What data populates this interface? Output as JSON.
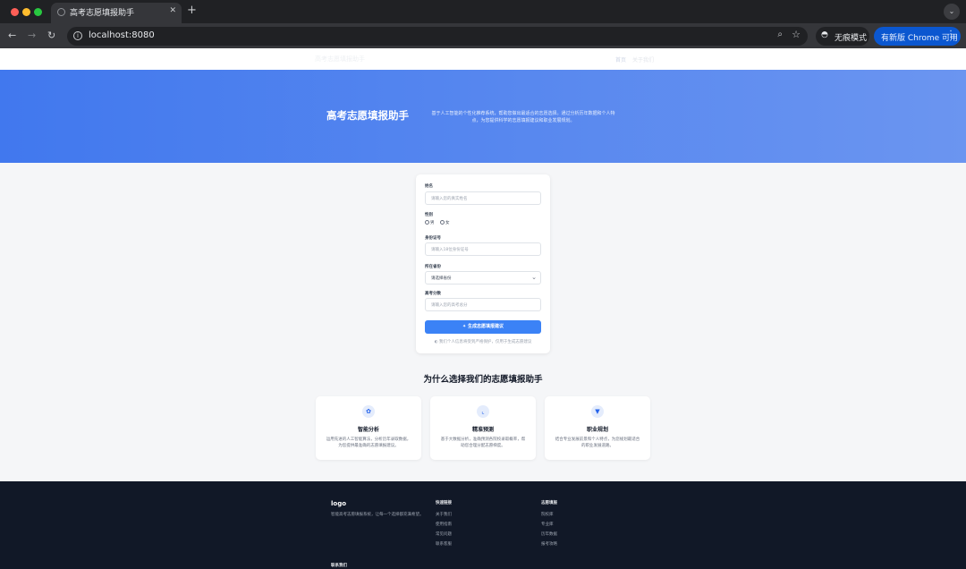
{
  "browser": {
    "tab_title": "高考志愿填报助手",
    "url": "localhost:8080",
    "incognito_label": "无痕模式",
    "update_label": "有新版 Chrome 可用"
  },
  "header": {
    "brand": "高考志愿填报助手",
    "nav": [
      "首页",
      "关于我们"
    ]
  },
  "hero": {
    "title": "高考志愿填报助手",
    "description": "基于人工智能的个性化推荐系统，帮助您做出最适合的志愿选择。通过分析历年数据和个人特点，为您提供科学的志愿填报建议和职业发展规划。"
  },
  "form": {
    "name_label": "姓名",
    "name_placeholder": "请输入您的真实姓名",
    "gender_label": "性别",
    "gender_options": [
      "男",
      "女"
    ],
    "id_label": "身份证号",
    "id_placeholder": "请输入18位身份证号",
    "province_label": "所在省份",
    "province_placeholder": "请选择省份",
    "score_label": "高考分数",
    "score_placeholder": "请输入您的高考总分",
    "submit_label": "生成志愿填报建议",
    "privacy_note": "我们个人信息将受到严格保护，仅用于生成志愿建议"
  },
  "why": {
    "title": "为什么选择我们的志愿填报助手",
    "features": [
      {
        "icon": "brain-icon",
        "title": "智能分析",
        "desc": "运用先进的人工智能算法，分析历年录取数据，为您提供最准确的志愿填报建议。"
      },
      {
        "icon": "chart-icon",
        "title": "精准预测",
        "desc": "基于大数据分析，准确预测各院校录取概率，帮助您合理分配志愿梯度。"
      },
      {
        "icon": "briefcase-icon",
        "title": "职业规划",
        "desc": "结合专业发展前景和个人特点，为您规划最适合的职业发展道路。"
      }
    ]
  },
  "footer": {
    "logo": "logo",
    "desc": "智能高考志愿填报系统，让每一个选择都充满希望。",
    "col1_title": "快速链接",
    "col1_links": [
      "关于我们",
      "使用指南",
      "常见问题",
      "联系客服"
    ],
    "col2_title": "志愿填报",
    "col2_links": [
      "院校库",
      "专业库",
      "历年数据",
      "报考攻略"
    ],
    "contact_title": "联系我们"
  }
}
